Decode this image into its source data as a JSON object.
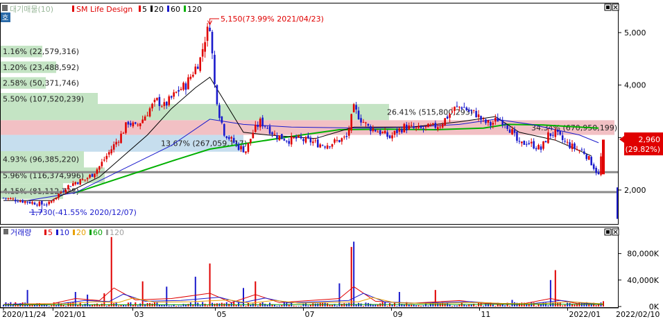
{
  "header": {
    "tag": "호",
    "title_prefix": "대기매물(10)",
    "stock_name": "SM Life Design",
    "ma_labels": [
      {
        "label": "5",
        "color": "#e00000"
      },
      {
        "label": "20",
        "color": "#000000"
      },
      {
        "label": "60",
        "color": "#1a1acc"
      },
      {
        "label": "120",
        "color": "#00b000"
      }
    ]
  },
  "price_axis": {
    "ticks": [
      "5,000",
      "4,000",
      "3,000",
      "2,000"
    ]
  },
  "volume_panel": {
    "title": "거래량",
    "ma_labels": [
      {
        "label": "5",
        "color": "#e00000"
      },
      {
        "label": "10",
        "color": "#1a1acc"
      },
      {
        "label": "20",
        "color": "#e8a000"
      },
      {
        "label": "60",
        "color": "#00a000"
      },
      {
        "label": "120",
        "color": "#a0a0a0"
      }
    ],
    "ticks": [
      "80,000K",
      "40,000K",
      "0K"
    ]
  },
  "x_axis": {
    "labels": [
      "2020/11/24",
      "2021/01",
      "03",
      "05",
      "07",
      "09",
      "11",
      "2022/01"
    ],
    "end_label": "2022/02/10"
  },
  "annotations": {
    "high": "5,150(73.99% 2021/04/23)",
    "low": "1,730(-41.55% 2020/12/07)"
  },
  "current_price": {
    "price": "2,960",
    "change": "(29.82%)"
  },
  "colors": {
    "up": "#e00000",
    "down": "#1a1acc",
    "ma5": "#e00000",
    "ma20": "#000000",
    "ma60": "#1a1acc",
    "ma120": "#00b000",
    "supply_green": "#c4e4c4",
    "supply_red": "#f2c0c4",
    "supply_blue": "#c6deee"
  },
  "chart_data": {
    "type": "candlestick",
    "price_range": [
      1450,
      5500
    ],
    "supply_zones": [
      {
        "label": "1.16% (22,579,316)",
        "price_low": 4530,
        "price_high": 4750
      },
      {
        "label": "1.20% (23,488,592)",
        "price_low": 4230,
        "price_high": 4450
      },
      {
        "label": "2.58% (50,371,746)",
        "price_low": 3930,
        "price_high": 4150
      },
      {
        "label": "5.50% (107,520,239)",
        "price_low": 3630,
        "price_high": 3850
      },
      {
        "label": "26.41% (515,800,293)",
        "price_low": 3330,
        "price_high": 3640
      },
      {
        "label": "34.34% (670,950,199)",
        "price_low": 3050,
        "price_high": 3330
      },
      {
        "label": "13.67% (267,059,117)",
        "price_low": 2730,
        "price_high": 3050
      },
      {
        "label": "4.93% (96,385,220)",
        "price_low": 2430,
        "price_high": 2740
      },
      {
        "label": "5.96% (116,374,996)",
        "price_low": 2130,
        "price_high": 2430
      },
      {
        "label": "4.15% (81,112,728)",
        "price_low": 1830,
        "price_high": 2130
      }
    ],
    "horizontal_lines": [
      2340,
      1960
    ],
    "price_path": [
      [
        0,
        1850
      ],
      [
        4,
        1820
      ],
      [
        8,
        1790
      ],
      [
        12,
        1760
      ],
      [
        16,
        1730
      ],
      [
        19,
        1740
      ],
      [
        22,
        1880
      ],
      [
        26,
        2050
      ],
      [
        30,
        2150
      ],
      [
        34,
        2200
      ],
      [
        37,
        2300
      ],
      [
        40,
        2450
      ],
      [
        43,
        2650
      ],
      [
        46,
        2850
      ],
      [
        49,
        3050
      ],
      [
        52,
        3300
      ],
      [
        55,
        3200
      ],
      [
        58,
        3350
      ],
      [
        61,
        3550
      ],
      [
        64,
        3700
      ],
      [
        67,
        3600
      ],
      [
        70,
        3750
      ],
      [
        73,
        3900
      ],
      [
        76,
        4000
      ],
      [
        79,
        4250
      ],
      [
        82,
        4500
      ],
      [
        84,
        4900
      ],
      [
        86,
        5150
      ],
      [
        88,
        4000
      ],
      [
        90,
        3450
      ],
      [
        92,
        3100
      ],
      [
        95,
        2950
      ],
      [
        98,
        2820
      ],
      [
        101,
        2750
      ],
      [
        104,
        3100
      ],
      [
        107,
        3300
      ],
      [
        110,
        3200
      ],
      [
        113,
        3050
      ],
      [
        116,
        3000
      ],
      [
        119,
        2950
      ],
      [
        122,
        2980
      ],
      [
        125,
        2950
      ],
      [
        128,
        2930
      ],
      [
        131,
        2880
      ],
      [
        134,
        2860
      ],
      [
        137,
        2900
      ],
      [
        140,
        2950
      ],
      [
        143,
        3000
      ],
      [
        146,
        3550
      ],
      [
        149,
        3350
      ],
      [
        152,
        3200
      ],
      [
        155,
        3150
      ],
      [
        158,
        3080
      ],
      [
        161,
        3000
      ],
      [
        164,
        3120
      ],
      [
        167,
        3200
      ],
      [
        170,
        3180
      ],
      [
        173,
        3150
      ],
      [
        176,
        3180
      ],
      [
        179,
        3200
      ],
      [
        182,
        3250
      ],
      [
        185,
        3400
      ],
      [
        188,
        3550
      ],
      [
        191,
        3600
      ],
      [
        194,
        3500
      ],
      [
        197,
        3450
      ],
      [
        200,
        3300
      ],
      [
        203,
        3250
      ],
      [
        206,
        3350
      ],
      [
        209,
        3300
      ],
      [
        212,
        3100
      ],
      [
        215,
        2850
      ],
      [
        218,
        2920
      ],
      [
        221,
        2850
      ],
      [
        224,
        2780
      ],
      [
        227,
        3050
      ],
      [
        230,
        3080
      ],
      [
        233,
        2950
      ],
      [
        236,
        2850
      ],
      [
        239,
        2780
      ],
      [
        242,
        2720
      ],
      [
        245,
        2520
      ],
      [
        248,
        2280
      ],
      [
        250,
        2960
      ]
    ],
    "ma20_path": [
      [
        0,
        1800
      ],
      [
        20,
        1800
      ],
      [
        40,
        2250
      ],
      [
        60,
        3050
      ],
      [
        70,
        3550
      ],
      [
        80,
        3950
      ],
      [
        86,
        4150
      ],
      [
        92,
        3700
      ],
      [
        100,
        3100
      ],
      [
        110,
        3050
      ],
      [
        130,
        2980
      ],
      [
        146,
        3200
      ],
      [
        170,
        3200
      ],
      [
        190,
        3300
      ],
      [
        205,
        3400
      ],
      [
        215,
        3100
      ],
      [
        230,
        2950
      ],
      [
        245,
        2650
      ]
    ],
    "ma60_path": [
      [
        10,
        1800
      ],
      [
        30,
        1950
      ],
      [
        50,
        2400
      ],
      [
        70,
        2850
      ],
      [
        86,
        3350
      ],
      [
        100,
        3250
      ],
      [
        120,
        3200
      ],
      [
        150,
        3180
      ],
      [
        170,
        3200
      ],
      [
        190,
        3250
      ],
      [
        205,
        3350
      ],
      [
        220,
        3250
      ],
      [
        240,
        3050
      ],
      [
        248,
        2900
      ]
    ],
    "ma120_path": [
      [
        30,
        1950
      ],
      [
        50,
        2250
      ],
      [
        70,
        2550
      ],
      [
        86,
        2780
      ],
      [
        100,
        2880
      ],
      [
        120,
        3020
      ],
      [
        140,
        3150
      ],
      [
        160,
        3160
      ],
      [
        180,
        3150
      ],
      [
        200,
        3180
      ],
      [
        210,
        3250
      ],
      [
        225,
        3240
      ],
      [
        240,
        3200
      ],
      [
        248,
        3180
      ]
    ],
    "volume_max_k": 110000,
    "volume_spikes": [
      [
        10,
        25000
      ],
      [
        30,
        22000
      ],
      [
        35,
        18000
      ],
      [
        42,
        20000
      ],
      [
        45,
        105000
      ],
      [
        58,
        38000
      ],
      [
        68,
        30000
      ],
      [
        80,
        45000
      ],
      [
        86,
        65000
      ],
      [
        100,
        28000
      ],
      [
        105,
        38000
      ],
      [
        140,
        35000
      ],
      [
        145,
        90000
      ],
      [
        146,
        98000
      ],
      [
        165,
        22000
      ],
      [
        180,
        25000
      ],
      [
        212,
        10000
      ],
      [
        228,
        40000
      ],
      [
        230,
        55000
      ],
      [
        250,
        8000
      ]
    ],
    "volume_ma_path": [
      [
        0,
        3000
      ],
      [
        20,
        4000
      ],
      [
        30,
        12000
      ],
      [
        40,
        9000
      ],
      [
        46,
        28000
      ],
      [
        55,
        10000
      ],
      [
        70,
        12000
      ],
      [
        86,
        20000
      ],
      [
        95,
        6000
      ],
      [
        105,
        18000
      ],
      [
        115,
        6000
      ],
      [
        140,
        12000
      ],
      [
        146,
        30000
      ],
      [
        155,
        8000
      ],
      [
        170,
        5000
      ],
      [
        190,
        9000
      ],
      [
        200,
        5000
      ],
      [
        215,
        3000
      ],
      [
        228,
        12000
      ],
      [
        240,
        4000
      ],
      [
        250,
        3000
      ]
    ]
  }
}
